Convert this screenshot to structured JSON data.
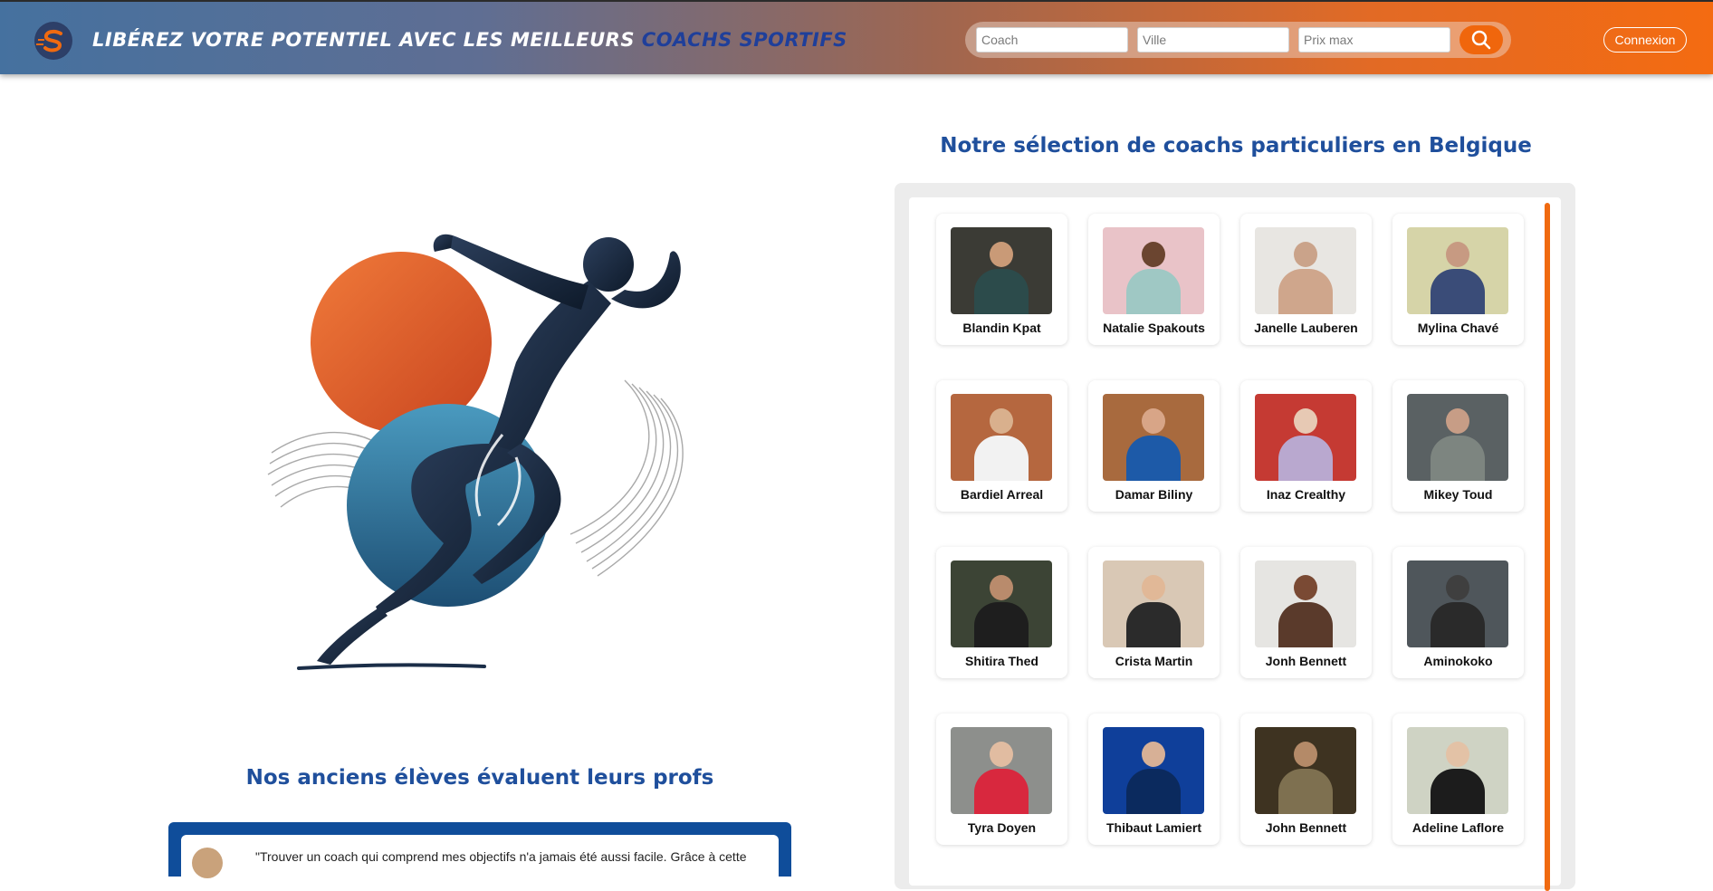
{
  "header": {
    "title_main": "LIBÉREZ VOTRE POTENTIEL AVEC LES MEILLEURS ",
    "title_accent": "COACHS SPORTIFS",
    "logo_icon": "s-logo-icon",
    "search": {
      "coach_placeholder": "Coach",
      "ville_placeholder": "Ville",
      "prix_placeholder": "Prix max",
      "button_icon": "search-icon"
    },
    "login_label": "Connexion"
  },
  "colors": {
    "accent_orange": "#f0660c",
    "title_blue": "#1f4f9c",
    "header_accent": "#1f3f9a"
  },
  "testimonials": {
    "title": "Nos anciens élèves évaluent leurs profs",
    "first_quote": "\"Trouver un coach qui comprend mes objectifs n'a jamais été aussi facile. Grâce à cette"
  },
  "coaches": {
    "title": "Notre sélection de coachs particuliers en Belgique",
    "list": [
      {
        "name": "Blandin Kpat",
        "bg": "#3b3b35",
        "skin": "#c99a77",
        "shirt": "#2c4b4b"
      },
      {
        "name": "Natalie Spakouts",
        "bg": "#e9c3c8",
        "skin": "#6b4530",
        "shirt": "#9fc8c4"
      },
      {
        "name": "Janelle Lauberen",
        "bg": "#e8e6e2",
        "skin": "#caa38a",
        "shirt": "#cfa68c"
      },
      {
        "name": "Mylina Chavé",
        "bg": "#d6d4a8",
        "skin": "#c79a82",
        "shirt": "#3a4c78"
      },
      {
        "name": "Bardiel Arreal",
        "bg": "#b5673f",
        "skin": "#d9b08d",
        "shirt": "#f2f2f2"
      },
      {
        "name": "Damar Biliny",
        "bg": "#a86a3e",
        "skin": "#d8a587",
        "shirt": "#1d5aa8"
      },
      {
        "name": "Inaz Crealthy",
        "bg": "#c53a33",
        "skin": "#e7c9b4",
        "shirt": "#b9a8cf"
      },
      {
        "name": "Mikey Toud",
        "bg": "#5a6163",
        "skin": "#c79d86",
        "shirt": "#7d8580"
      },
      {
        "name": "Shitira Thed",
        "bg": "#3c4435",
        "skin": "#b98b6c",
        "shirt": "#1e1e1e"
      },
      {
        "name": "Crista Martin",
        "bg": "#d9c8b5",
        "skin": "#e1b897",
        "shirt": "#2b2b2b"
      },
      {
        "name": "Jonh Bennett",
        "bg": "#e6e5e2",
        "skin": "#7a4a34",
        "shirt": "#5a3a2b"
      },
      {
        "name": "Aminokoko",
        "bg": "#4f565b",
        "skin": "#3f3f3f",
        "shirt": "#2a2a2a"
      },
      {
        "name": "Tyra Doyen",
        "bg": "#8d8f8c",
        "skin": "#e1bca1",
        "shirt": "#d8283e"
      },
      {
        "name": "Thibaut Lamiert",
        "bg": "#0f3f9a",
        "skin": "#d7b096",
        "shirt": "#0b2a5e"
      },
      {
        "name": "John Bennett",
        "bg": "#3e3321",
        "skin": "#b48a68",
        "shirt": "#7e7050"
      },
      {
        "name": "Adeline Laflore",
        "bg": "#cfd3c4",
        "skin": "#e3c2a6",
        "shirt": "#1c1c1c"
      }
    ]
  }
}
